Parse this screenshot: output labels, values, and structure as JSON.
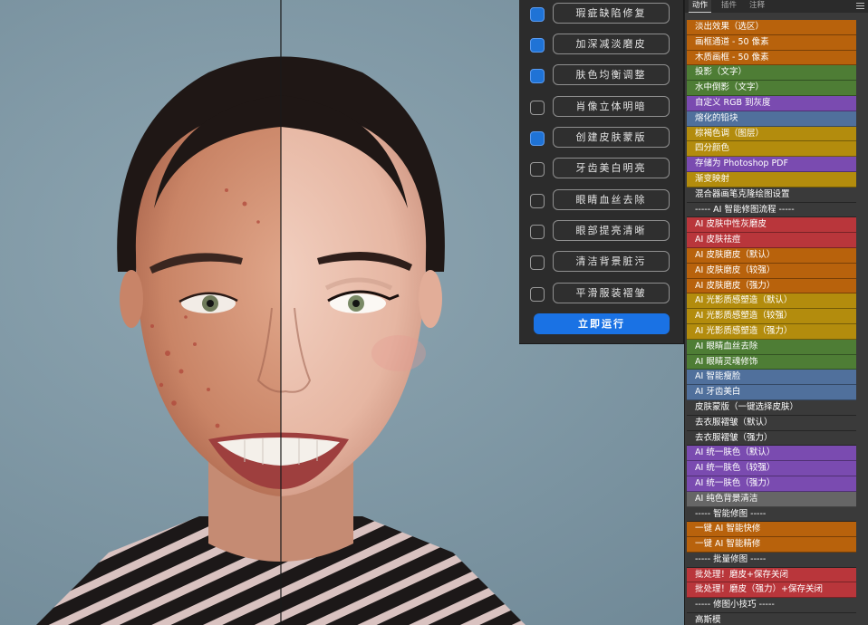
{
  "colors": {
    "orange": "#b8620c",
    "green": "#4e7d35",
    "purple": "#7a4bb0",
    "blue": "#50709c",
    "gold": "#b38c0d",
    "dark": "#3a3a3a",
    "red": "#b9363b",
    "gray": "#666666",
    "checkbox_on": "#1f73d6",
    "run_button": "#1a72e4"
  },
  "retouch_options": [
    {
      "label": "瑕疵缺陷修复",
      "checked": true
    },
    {
      "label": "加深减淡磨皮",
      "checked": true
    },
    {
      "label": "肤色均衡调整",
      "checked": true
    },
    {
      "label": "肖像立体明暗",
      "checked": false
    },
    {
      "label": "创建皮肤蒙版",
      "checked": true
    },
    {
      "label": "牙齿美白明亮",
      "checked": false
    },
    {
      "label": "眼睛血丝去除",
      "checked": false
    },
    {
      "label": "眼部提亮清晰",
      "checked": false
    },
    {
      "label": "清洁背景脏污",
      "checked": false
    },
    {
      "label": "平滑服装褶皱",
      "checked": false
    }
  ],
  "run_button_label": "立即运行",
  "tabs": [
    "动作",
    "插件",
    "注释"
  ],
  "actions": [
    {
      "label": "淡出效果（选区）",
      "color": "orange"
    },
    {
      "label": "画框通道 - 50 像素",
      "color": "orange"
    },
    {
      "label": "木质画框 - 50 像素",
      "color": "orange"
    },
    {
      "label": "投影（文字）",
      "color": "green"
    },
    {
      "label": "水中倒影（文字）",
      "color": "green"
    },
    {
      "label": "自定义 RGB 到灰度",
      "color": "purple"
    },
    {
      "label": "熔化的铅块",
      "color": "blue"
    },
    {
      "label": "棕褐色调（图层）",
      "color": "gold"
    },
    {
      "label": "四分颜色",
      "color": "gold"
    },
    {
      "label": "存储为 Photoshop PDF",
      "color": "purple"
    },
    {
      "label": "渐变映射",
      "color": "gold"
    },
    {
      "label": "混合器画笔克隆绘图设置",
      "color": "dark"
    },
    {
      "label": "----- AI 智能修图流程 -----",
      "color": "dark"
    },
    {
      "label": "AI 皮肤中性灰磨皮",
      "color": "red"
    },
    {
      "label": "AI 皮肤祛痘",
      "color": "red"
    },
    {
      "label": "AI 皮肤磨皮（默认）",
      "color": "orange"
    },
    {
      "label": "AI 皮肤磨皮（较强）",
      "color": "orange"
    },
    {
      "label": "AI 皮肤磨皮（强力）",
      "color": "orange"
    },
    {
      "label": "AI 光影质感塑造（默认）",
      "color": "gold"
    },
    {
      "label": "AI 光影质感塑造（较强）",
      "color": "gold"
    },
    {
      "label": "AI 光影质感塑造（强力）",
      "color": "gold"
    },
    {
      "label": "AI 眼睛血丝去除",
      "color": "green"
    },
    {
      "label": "AI 眼睛灵魂修饰",
      "color": "green"
    },
    {
      "label": "AI 智能瘦脸",
      "color": "blue"
    },
    {
      "label": "AI 牙齿美白",
      "color": "blue"
    },
    {
      "label": "皮肤蒙版（一键选择皮肤）",
      "color": "dark"
    },
    {
      "label": "去衣服褶皱（默认）",
      "color": "dark"
    },
    {
      "label": "去衣服褶皱（强力）",
      "color": "dark"
    },
    {
      "label": "AI 统一肤色（默认）",
      "color": "purple"
    },
    {
      "label": "AI 统一肤色（较强）",
      "color": "purple"
    },
    {
      "label": "AI 统一肤色（强力）",
      "color": "purple"
    },
    {
      "label": "AI 纯色背景清洁",
      "color": "gray"
    },
    {
      "label": "----- 智能修图 -----",
      "color": "dark"
    },
    {
      "label": "一键 AI 智能快修",
      "color": "orange"
    },
    {
      "label": "一键 AI 智能精修",
      "color": "orange"
    },
    {
      "label": "----- 批量修图 -----",
      "color": "dark"
    },
    {
      "label": "批处理！磨皮+保存关闭",
      "color": "red"
    },
    {
      "label": "批处理！磨皮（强力）+保存关闭",
      "color": "red"
    },
    {
      "label": "----- 修图小技巧 -----",
      "color": "dark"
    },
    {
      "label": "高斯模",
      "color": "dark"
    }
  ]
}
